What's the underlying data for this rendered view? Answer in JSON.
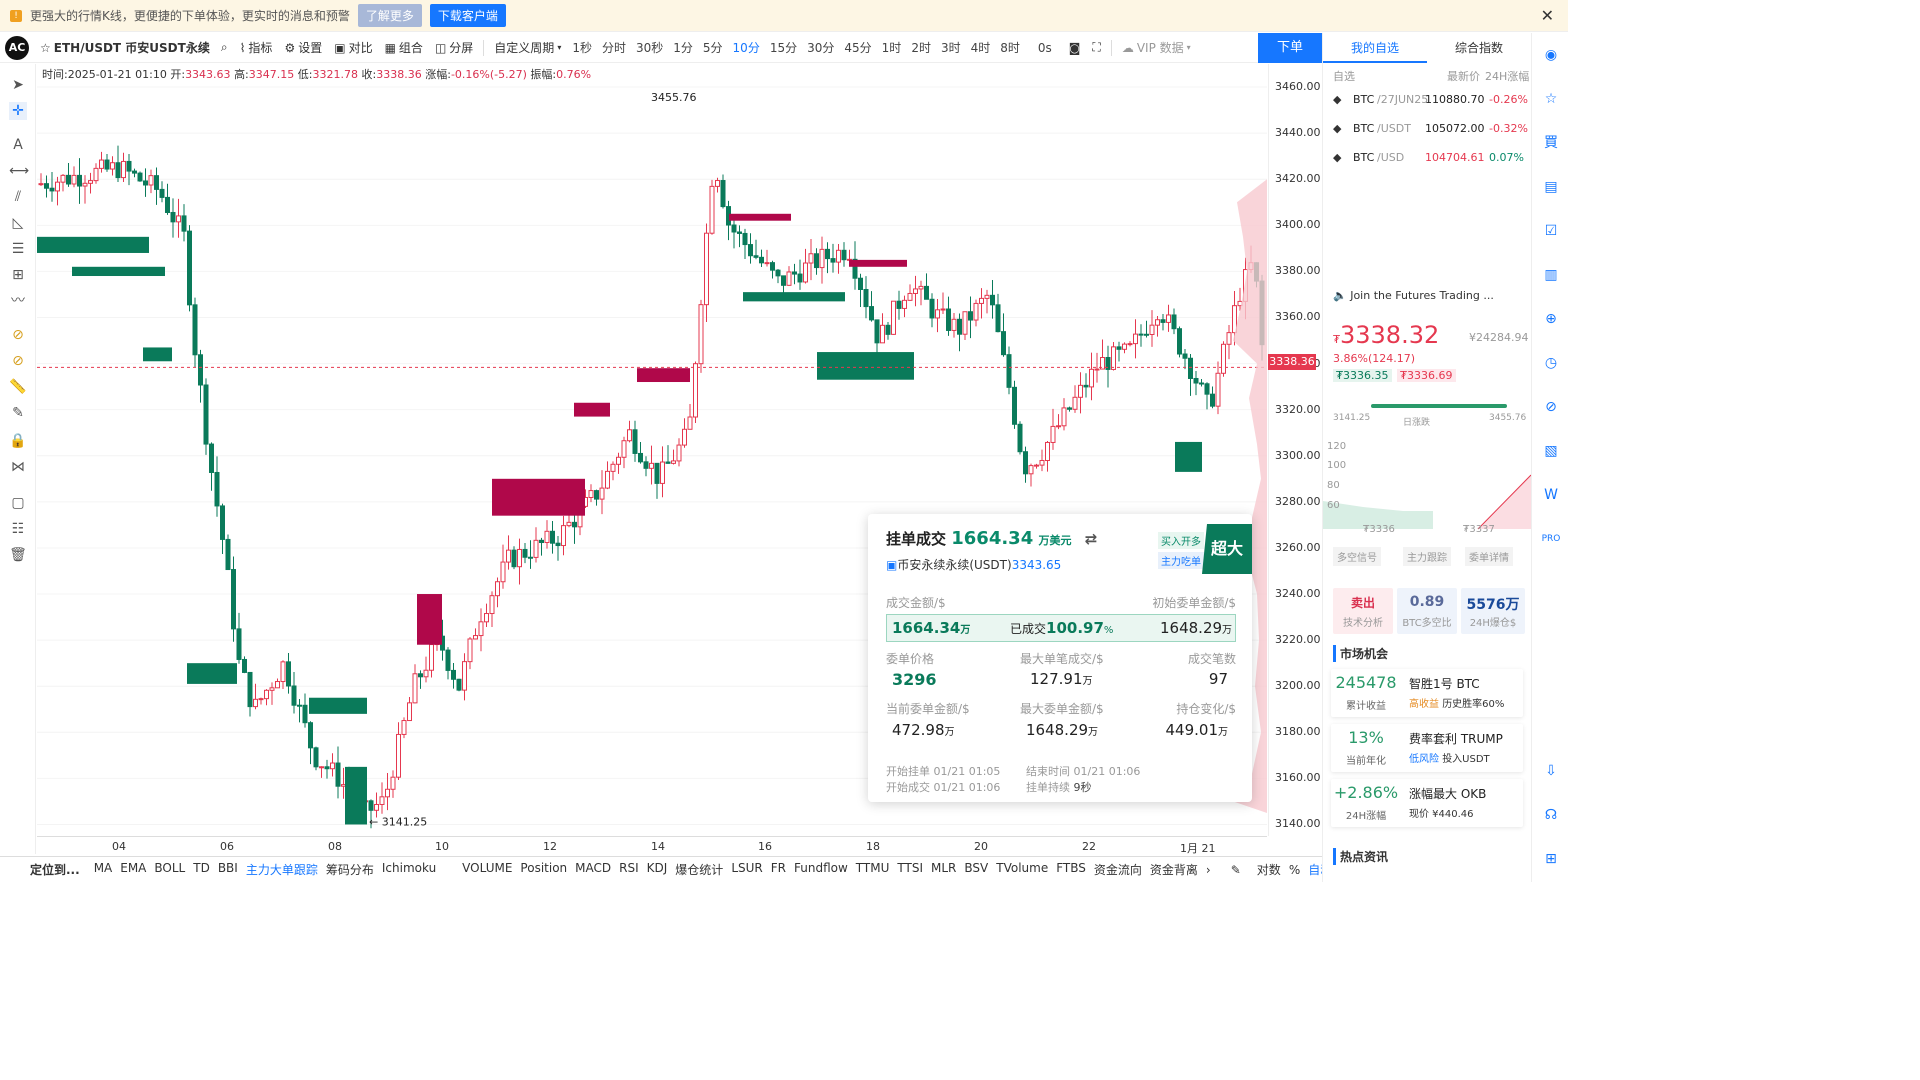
{
  "banner": {
    "text": "更强大的行情K线，更便捷的下单体验，更实时的消息和预警",
    "learn_more": "了解更多",
    "download": "下载客户端"
  },
  "toolbar": {
    "symbol": "ETH/USDT 币安USDT永续",
    "indicators": "指标",
    "settings": "设置",
    "compare": "对比",
    "combine": "组合",
    "split": "分屏",
    "custom_period": "自定义周期",
    "timeframes": [
      "1秒",
      "分时",
      "30秒",
      "1分",
      "5分",
      "10分",
      "15分",
      "30分",
      "45分",
      "1时",
      "2时",
      "3时",
      "4时",
      "8时"
    ],
    "active_timeframe": "10分",
    "countdown": "0s",
    "vip": "VIP 数据",
    "order": "下单"
  },
  "ohlc": {
    "time": "时间:2025-01-21 01:10",
    "open_label": "开:",
    "open": "3343.63",
    "high_label": "高:",
    "high": "3347.15",
    "low_label": "低:",
    "low": "3321.78",
    "close_label": "收:",
    "close": "3338.36",
    "change_label": "涨幅:",
    "change": "-0.16%(-5.27)",
    "amp_label": "振幅:",
    "amp": "0.76%"
  },
  "chart_data": {
    "type": "candlestick",
    "y_ticks": [
      "3460.00",
      "3440.00",
      "3420.00",
      "3400.00",
      "3380.00",
      "3360.00",
      "3340.00",
      "3320.00",
      "3300.00",
      "3280.00",
      "3260.00",
      "3240.00",
      "3220.00",
      "3200.00",
      "3180.00",
      "3160.00",
      "3140.00"
    ],
    "x_ticks": [
      "04",
      "06",
      "08",
      "10",
      "12",
      "14",
      "16",
      "18",
      "20",
      "22",
      "1月 21"
    ],
    "high_marker": "3455.76",
    "low_marker": "← 3141.25",
    "last_price": "3338.36",
    "ylim": [
      3135,
      3470
    ]
  },
  "popup": {
    "title": "挂单成交",
    "amount": "1664.34",
    "amount_unit": "万美元",
    "subtitle": "币安永续永续(USDT)",
    "subtitle_price": "3343.65",
    "badge_buy": "买入开多",
    "badge_main": "主力吃单",
    "size_tag": "超大",
    "fill_amount_label": "成交金额/$",
    "init_amount_label": "初始委单金额/$",
    "fill_amount": "1664.34",
    "wan": "万",
    "filled_label": "已成交",
    "filled_pct": "100.97",
    "pct": "%",
    "init_amount": "1648.29",
    "order_price_label": "委单价格",
    "order_price": "3296",
    "max_single_label": "最大单笔成交/$",
    "max_single": "127.91",
    "fill_count_label": "成交笔数",
    "fill_count": "97",
    "cur_amount_label": "当前委单金额/$",
    "cur_amount": "472.98",
    "max_order_label": "最大委单金额/$",
    "max_order": "1648.29",
    "oi_change_label": "持仓变化/$",
    "oi_change": "449.01",
    "start_order_label": "开始挂单",
    "start_order": "01/21 01:05",
    "start_fill_label": "开始成交",
    "start_fill": "01/21 01:06",
    "end_label": "结束时间",
    "end": "01/21 01:06",
    "duration_label": "挂单持续",
    "duration": "9秒"
  },
  "bottom": {
    "locate": "定位到...",
    "items": [
      "MA",
      "EMA",
      "BOLL",
      "TD",
      "BBI",
      "主力大单跟踪",
      "筹码分布",
      "Ichimoku",
      "VOLUME",
      "Position",
      "MACD",
      "RSI",
      "KDJ",
      "爆仓统计",
      "LSUR",
      "FR",
      "Fundflow",
      "TTMU",
      "TTSI",
      "MLR",
      "BSV",
      "TVolume",
      "FTBS",
      "资金流向",
      "资金背离"
    ],
    "active": "主力大单跟踪",
    "log": "对数",
    "pct": "%",
    "auto": "自动"
  },
  "right": {
    "tab_watch": "我的自选",
    "tab_index": "综合指数",
    "head_watch": "自选",
    "head_latest": "最新价",
    "head_24h": "24H涨幅",
    "watchlist": [
      {
        "name": "BTC",
        "quote": "/27JUN25",
        "price": "110880.70",
        "chg": "-0.26%"
      },
      {
        "name": "BTC",
        "quote": "/USDT",
        "price": "105072.00",
        "chg": "-0.32%"
      },
      {
        "name": "BTC",
        "quote": "/USD",
        "price": "104704.61",
        "chg": "0.07%"
      }
    ],
    "notice": "Join the Futures Trading ...",
    "price": "3338.32",
    "price_cny": "¥24284.94",
    "change": "3.86%(124.17)",
    "bid": "₮3336.35",
    "ask": "₮3336.69",
    "range_low": "3141.25",
    "range_mid": "日涨跌",
    "range_high": "3455.76",
    "mini_ticks": [
      "120",
      "100",
      "80",
      "60"
    ],
    "mini_bottom_left": "₮3336",
    "mini_bottom_right": "₮3337",
    "tab_signal": "多空信号",
    "tab_main": "主力跟踪",
    "tab_orders": "委单详情",
    "stat_sell": "卖出",
    "stat_sell_sub": "技术分析",
    "stat_ratio": "0.89",
    "stat_ratio_sub": "BTC多空比",
    "stat_liq": "5576万",
    "stat_liq_sub": "24H爆仓$",
    "market_title": "市场机会",
    "opps": [
      {
        "num": "245478",
        "num_sub": "累计收益",
        "title": "智胜1号 BTC",
        "tag": "高收益",
        "desc": "历史胜率60%"
      },
      {
        "num": "13%",
        "num_sub": "当前年化",
        "title": "费率套利 TRUMP",
        "tag": "低风险",
        "desc": "投入USDT"
      },
      {
        "num": "+2.86%",
        "num_sub": "24H涨幅",
        "title": "涨幅最大 OKB",
        "tag": "",
        "desc": "现价 ¥440.46"
      }
    ],
    "news_title": "热点资讯"
  },
  "colors": {
    "up": "#d9304f",
    "down": "#0a7a5a",
    "accent": "#1677ff"
  }
}
